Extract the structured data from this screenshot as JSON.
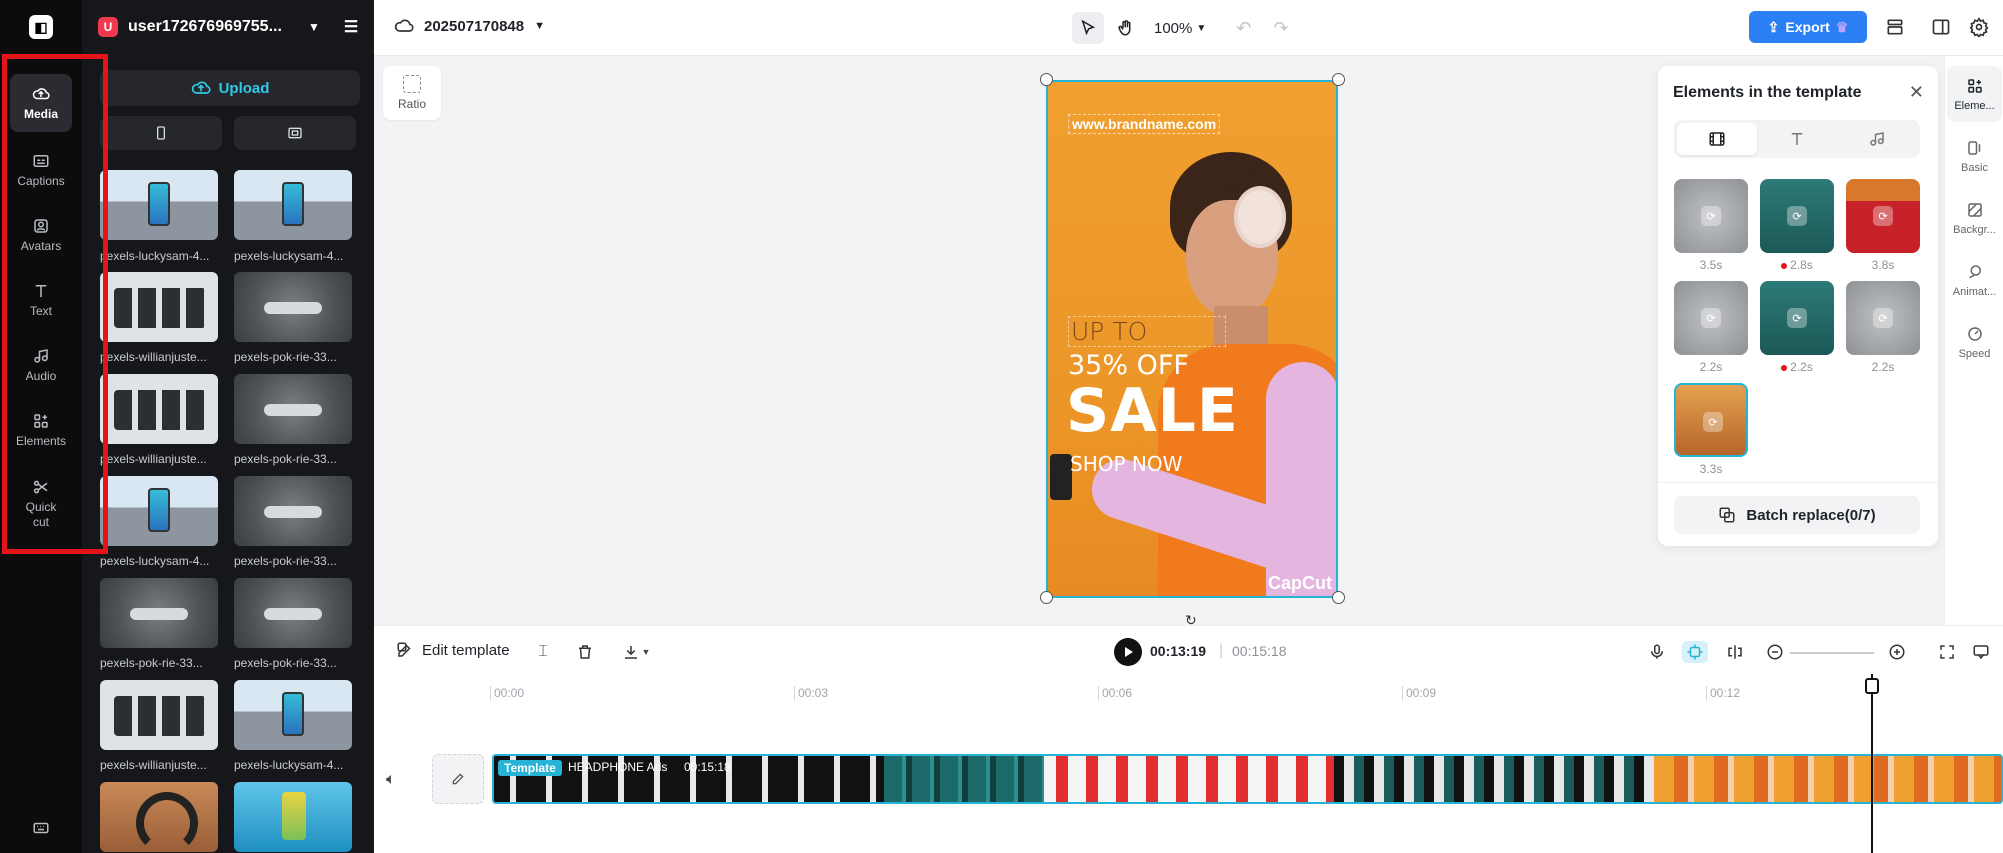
{
  "rail": {
    "logo": "CapCut",
    "items": [
      {
        "label": "Media",
        "icon": "cloud-upload-icon"
      },
      {
        "label": "Captions",
        "icon": "captions-icon"
      },
      {
        "label": "Avatars",
        "icon": "avatar-icon"
      },
      {
        "label": "Text",
        "icon": "text-icon"
      },
      {
        "label": "Audio",
        "icon": "music-note-icon"
      },
      {
        "label": "Elements",
        "icon": "elements-icon"
      },
      {
        "label": "Quick cut",
        "icon": "scissors-icon"
      }
    ],
    "bottom_icon": "keyboard-icon"
  },
  "media": {
    "user_badge": "U",
    "username": "user172676969755...",
    "upload_label": "Upload",
    "items": [
      {
        "name": "pexels-luckysam-4..."
      },
      {
        "name": "pexels-luckysam-4..."
      },
      {
        "name": "pexels-willianjuste..."
      },
      {
        "name": "pexels-pok-rie-33..."
      },
      {
        "name": "pexels-willianjuste..."
      },
      {
        "name": "pexels-pok-rie-33..."
      },
      {
        "name": "pexels-luckysam-4..."
      },
      {
        "name": "pexels-pok-rie-33..."
      },
      {
        "name": "pexels-pok-rie-33..."
      },
      {
        "name": "pexels-pok-rie-33..."
      },
      {
        "name": "pexels-willianjuste..."
      },
      {
        "name": "pexels-luckysam-4..."
      },
      {
        "name": ""
      },
      {
        "name": ""
      }
    ]
  },
  "topbar": {
    "project_name": "202507170848",
    "zoom": "100%",
    "export_label": "Export"
  },
  "canvas": {
    "ratio_label": "Ratio",
    "brand_url": "www.brandname.com",
    "promo_up_to": "UP TO",
    "promo_discount": "35% OFF",
    "promo_sale": "SALE",
    "promo_cta": "SHOP NOW",
    "watermark": "CapCut"
  },
  "elements_panel": {
    "title": "Elements in the template",
    "tabs": [
      "video-tab",
      "text-tab",
      "audio-tab"
    ],
    "cards": [
      {
        "duration": "3.5s",
        "flag": false
      },
      {
        "duration": "2.8s",
        "flag": true
      },
      {
        "duration": "3.8s",
        "flag": false
      },
      {
        "duration": "2.2s",
        "flag": false
      },
      {
        "duration": "2.2s",
        "flag": true
      },
      {
        "duration": "2.2s",
        "flag": false
      },
      {
        "duration": "3.3s",
        "flag": false
      }
    ],
    "batch_label": "Batch replace(0/7)"
  },
  "right_rail": {
    "items": [
      {
        "label": "Eleme...",
        "icon": "elements-icon"
      },
      {
        "label": "Basic",
        "icon": "basic-icon"
      },
      {
        "label": "Backgr...",
        "icon": "background-icon"
      },
      {
        "label": "Animat...",
        "icon": "animation-icon"
      },
      {
        "label": "Speed",
        "icon": "speed-icon"
      }
    ]
  },
  "timeline": {
    "edit_template_label": "Edit template",
    "current_time": "00:13:19",
    "total_time": "00:15:18",
    "ruler": [
      "00:00",
      "00:03",
      "00:06",
      "00:09",
      "00:12"
    ],
    "clip_tag": "Template",
    "clip_name": "HEADPHONE Ads",
    "clip_duration": "00:15:18"
  },
  "colors": {
    "accent": "#25b3d6",
    "export": "#2b7ff5",
    "highlight_box": "#e5141a"
  }
}
